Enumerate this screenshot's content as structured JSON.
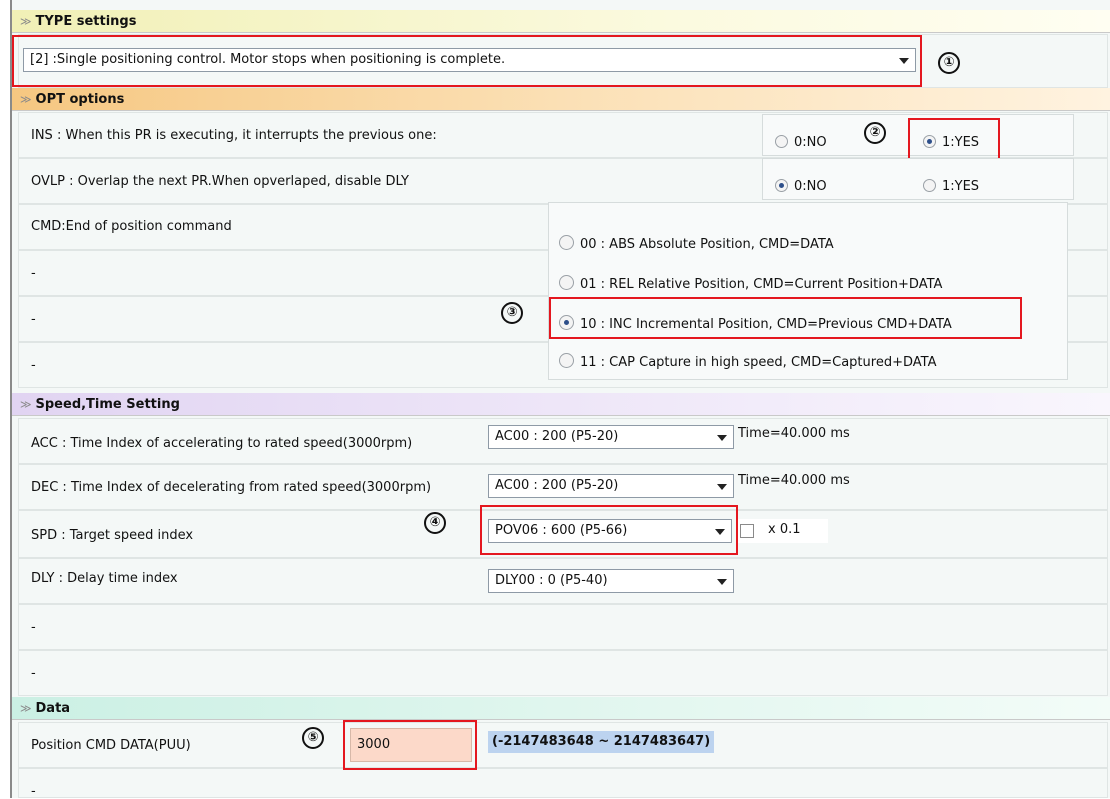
{
  "type_section": {
    "header": "TYPE settings",
    "dropdown_value": "[2] :Single positioning control.  Motor stops when positioning is complete.",
    "marker": "①"
  },
  "opt_section": {
    "header": "OPT options",
    "ins": {
      "label": "INS : When this PR is executing, it interrupts the previous one:",
      "opt_no": "0:NO",
      "opt_yes": "1:YES",
      "selected": "1:YES",
      "marker": "②"
    },
    "ovlp": {
      "label": "OVLP : Overlap the next PR.When opverlaped, disable DLY",
      "opt_no": "0:NO",
      "opt_yes": "1:YES",
      "selected": "0:NO"
    },
    "cmd": {
      "label": "CMD:End of position command",
      "marker": "③",
      "options": [
        "00 : ABS Absolute Position, CMD=DATA",
        "01 : REL Relative Position, CMD=Current Position+DATA",
        "10 : INC Incremental Position, CMD=Previous CMD+DATA",
        "11 : CAP Capture in high speed, CMD=Captured+DATA"
      ],
      "selected": "10 : INC Incremental Position, CMD=Previous CMD+DATA"
    },
    "blank_rows": [
      "-",
      "-",
      "-"
    ]
  },
  "speed_section": {
    "header": "Speed,Time Setting",
    "acc": {
      "label": "ACC : Time Index of accelerating to rated speed(3000rpm)",
      "value": "AC00 : 200 (P5-20)",
      "time": "Time=40.000 ms"
    },
    "dec": {
      "label": "DEC : Time Index of decelerating from rated speed(3000rpm)",
      "value": "AC00 : 200 (P5-20)",
      "time": "Time=40.000 ms"
    },
    "spd": {
      "label": "SPD : Target speed index",
      "value": "POV06 : 600 (P5-66)",
      "multiplier": "x 0.1",
      "multiplier_checked": false,
      "marker": "④"
    },
    "dly": {
      "label": "DLY : Delay time index",
      "value": "DLY00 : 0 (P5-40)"
    },
    "blank_rows": [
      "-",
      "-"
    ]
  },
  "data_section": {
    "header": "Data",
    "position": {
      "label": "Position CMD DATA(PUU)",
      "value": "3000",
      "range": "(-2147483648 ~ 2147483647)",
      "marker": "⑤"
    },
    "blank_rows": [
      "-"
    ]
  },
  "colors": {
    "annotation_red": "#e4171f",
    "data_input_bg": "#fcd9c9",
    "range_bg": "#bcd3ef"
  }
}
